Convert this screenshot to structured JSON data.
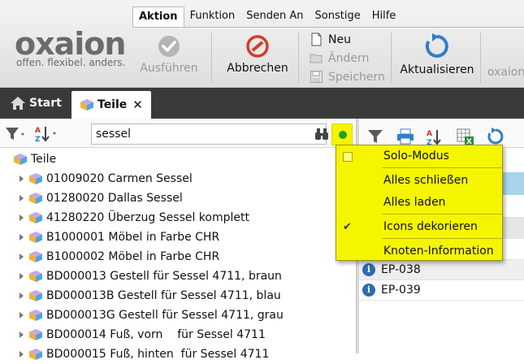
{
  "app": {
    "logo_word": "oxaion",
    "logo_tagline": "offen. flexibel. anders."
  },
  "menu": {
    "tabs": [
      {
        "label": "Aktion",
        "active": true
      },
      {
        "label": "Funktion"
      },
      {
        "label": "Senden An"
      },
      {
        "label": "Sonstige"
      },
      {
        "label": "Hilfe"
      }
    ]
  },
  "toolbar": {
    "ausfuehren": "Ausführen",
    "abbrechen": "Abbrechen",
    "neu": "Neu",
    "aendern": "Ändern",
    "speichern": "Speichern",
    "aktualisieren": "Aktualisieren",
    "overflow": "oxaion"
  },
  "tabs": {
    "start": "Start",
    "teile": "Teile",
    "close": "✕"
  },
  "search": {
    "value": "sessel"
  },
  "tree": {
    "root": "Teile",
    "items": [
      "01009020 Carmen Sessel",
      "01280020 Dallas Sessel",
      "41280220 Überzug Sessel komplett",
      "B1000001 Möbel in Farbe CHR",
      "B1000002 Möbel in Farbe CHR",
      "BD000013 Gestell für Sessel 4711, braun",
      "BD000013B Gestell für Sessel 4711, blau",
      "BD000013G Gestell für Sessel 4711, grau",
      "BD000014 Fuß, vorn    für Sessel 4711",
      "BD000015 Fuß, hinten  für Sessel 4711"
    ]
  },
  "right_list": {
    "items": [
      "EP-038",
      "EP-039"
    ]
  },
  "dropdown": {
    "items": [
      {
        "label": "Solo-Modus",
        "checkbox": true,
        "checked": false
      },
      {
        "label": "Alles schließen"
      },
      {
        "label": "Alles laden"
      },
      {
        "label": "Icons dekorieren",
        "checked": true
      },
      {
        "label": "Knoten-Information"
      }
    ],
    "check_mark": "✔"
  },
  "colors": {
    "highlight": "#f5f500",
    "tabbar": "#3a3a3a",
    "accent_blue": "#2b6cb0",
    "selected_row": "#a8d4ee",
    "status_green": "#26a026",
    "cancel_red": "#d23b2b"
  }
}
